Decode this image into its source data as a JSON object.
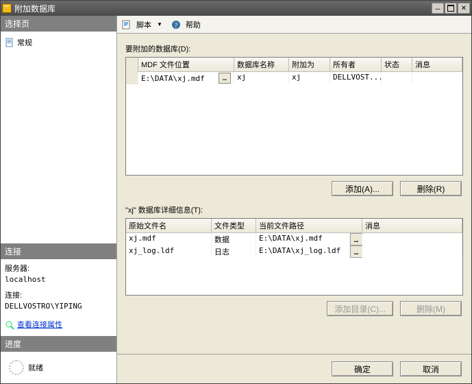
{
  "window": {
    "title": "附加数据库"
  },
  "left": {
    "select_page": "选择页",
    "general": "常规",
    "connection": "连接",
    "server_label": "服务器:",
    "server_value": "localhost",
    "conn_label": "连接:",
    "conn_value": "DELLVOSTRO\\YIPING",
    "view_conn_props": "查看连接属性",
    "progress": "进度",
    "ready": "就绪"
  },
  "toolbar": {
    "script": "脚本",
    "help": "帮助"
  },
  "main": {
    "attach_label": "要附加的数据库(D):",
    "cols": {
      "mdf": "MDF 文件位置",
      "dbname": "数据库名称",
      "attach_as": "附加为",
      "owner": "所有者",
      "status": "状态",
      "message": "消息"
    },
    "row": {
      "mdf": "E:\\DATA\\xj.mdf",
      "dbname": "xj",
      "attach_as": "xj",
      "owner": "DELLVOST..."
    },
    "add_btn": "添加(A)...",
    "remove_btn": "删除(R)",
    "details_label": "\"xj\" 数据库详细信息(T):",
    "cols2": {
      "orig": "原始文件名",
      "type": "文件类型",
      "path": "当前文件路径",
      "msg": "消息"
    },
    "rows2": [
      {
        "orig": "xj.mdf",
        "type": "数据",
        "path": "E:\\DATA\\xj.mdf"
      },
      {
        "orig": "xj_log.ldf",
        "type": "日志",
        "path": "E:\\DATA\\xj_log.ldf"
      }
    ],
    "add_dir_btn": "添加目录(C)...",
    "remove2_btn": "删除(M)"
  },
  "footer": {
    "ok": "确定",
    "cancel": "取消"
  }
}
